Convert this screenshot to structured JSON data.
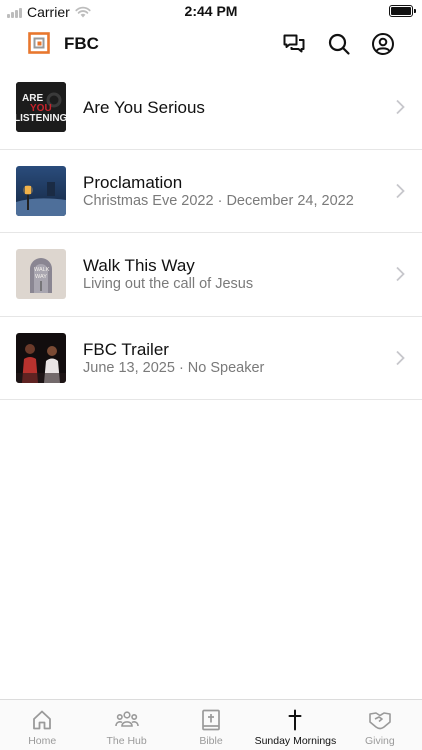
{
  "status_bar": {
    "carrier": "Carrier",
    "time": "2:44 PM"
  },
  "header": {
    "title": "FBC"
  },
  "sermons": [
    {
      "title": "Are You Serious",
      "subtitle": "",
      "thumb": "are-you-listening"
    },
    {
      "title": "Proclamation",
      "subtitle": "Christmas Eve 2022 · December 24, 2022",
      "thumb": "proclamation"
    },
    {
      "title": "Walk This Way",
      "subtitle": "Living out the call of Jesus",
      "thumb": "walk-this-way"
    },
    {
      "title": "FBC Trailer",
      "subtitle": "June 13, 2025 · No Speaker",
      "thumb": "fbc-trailer"
    }
  ],
  "thumb_text": {
    "line1": "ARE",
    "line2": "YOU",
    "line3": "LISTENING",
    "walk1": "WALK",
    "walk2": "WAY"
  },
  "tabs": [
    {
      "label": "Home",
      "icon": "home-icon",
      "active": false
    },
    {
      "label": "The Hub",
      "icon": "people-icon",
      "active": false
    },
    {
      "label": "Bible",
      "icon": "bible-icon",
      "active": false
    },
    {
      "label": "Sunday Mornings",
      "icon": "cross-icon",
      "active": true
    },
    {
      "label": "Giving",
      "icon": "giving-icon",
      "active": false
    }
  ],
  "colors": {
    "accent": "#e8772e",
    "text": "#111111",
    "muted": "#7a7a7a",
    "tab_inactive": "#9a9a9a"
  }
}
